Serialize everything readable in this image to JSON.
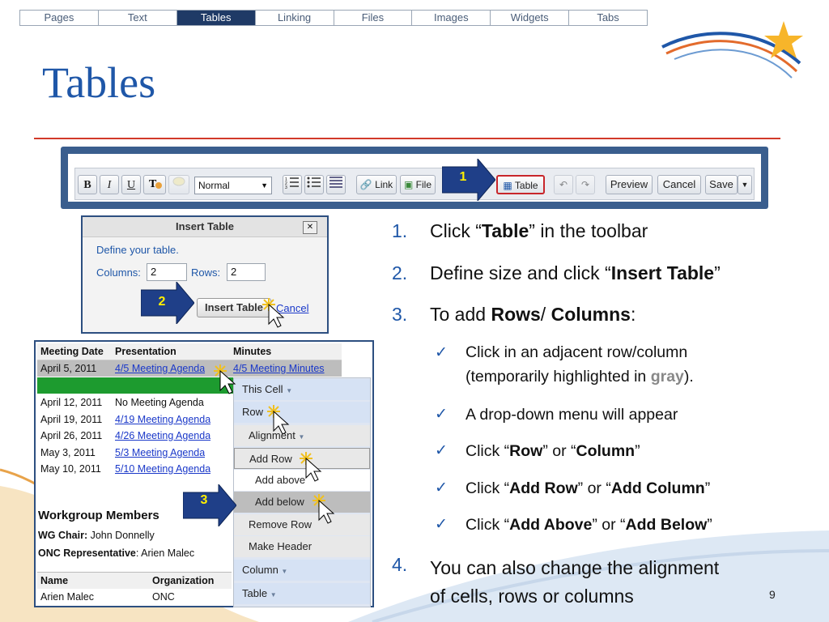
{
  "nav_tabs": [
    "Pages",
    "Text",
    "Tables",
    "Linking",
    "Files",
    "Images",
    "Widgets",
    "Tabs"
  ],
  "active_tab": "Tables",
  "title": "Tables",
  "toolbar": {
    "bold": "B",
    "italic": "I",
    "underline": "U",
    "format_value": "Normal",
    "link_label": "Link",
    "file_label": "File",
    "table_label": "Table",
    "preview_label": "Preview",
    "cancel_label": "Cancel",
    "save_label": "Save",
    "badge": "1"
  },
  "dialog": {
    "title": "Insert Table",
    "close": "✕",
    "prompt": "Define your table.",
    "columns_label": "Columns:",
    "columns_value": "2",
    "rows_label": "Rows:",
    "rows_value": "2",
    "insert_label": "Insert Table",
    "cancel_label": "Cancel",
    "badge": "2"
  },
  "meeting_table": {
    "headers": [
      "Meeting Date",
      "Presentation",
      "Minutes"
    ],
    "rows": [
      [
        "April 5, 2011",
        "4/5 Meeting Agenda",
        "4/5 Meeting Minutes"
      ],
      [
        "",
        "",
        ""
      ],
      [
        "April 12, 2011",
        "No Meeting Agenda",
        ""
      ],
      [
        "April 19, 2011",
        "4/19 Meeting Agenda",
        ""
      ],
      [
        "April 26, 2011",
        "4/26 Meeting Agenda",
        ""
      ],
      [
        "May 3, 2011",
        "5/3 Meeting Agenda",
        ""
      ],
      [
        "May 10, 2011",
        "5/10 Meeting Agenda",
        ""
      ]
    ],
    "section_title": "Workgroup Members",
    "wg_chair_label": "WG Chair:",
    "wg_chair_value": "John Donnelly",
    "onc_label": "ONC Representative",
    "onc_value": ": Arien Malec",
    "member_headers": [
      "Name",
      "Organization"
    ],
    "member_row": [
      "Arien Malec",
      "ONC"
    ],
    "badge": "3"
  },
  "context_menu": {
    "items": [
      "This Cell",
      "Row",
      "Alignment",
      "Add Row",
      "Add above",
      "Add below",
      "Remove Row",
      "Make Header",
      "Column",
      "Table"
    ]
  },
  "instructions": {
    "step1_a": "Click “",
    "step1_b": "Table",
    "step1_c": "” in the toolbar",
    "step2_a": "Define size and click “",
    "step2_b": "Insert Table",
    "step2_c": "”",
    "step3_a": "To add ",
    "step3_b": "Rows",
    "step3_c": "/ ",
    "step3_d": "Columns",
    "step3_e": ":",
    "b1_a": "Click in an adjacent row/column",
    "b1_b": "(temporarily highlighted in ",
    "b1_c": "gray",
    "b1_d": ").",
    "b2": "A drop-down menu will appear",
    "b3_a": "Click “",
    "b3_b": "Row",
    "b3_c": "” or “",
    "b3_d": "Column",
    "b3_e": "”",
    "b4_a": "Click “",
    "b4_b": "Add Row",
    "b4_c": "” or “",
    "b4_d": "Add Column",
    "b4_e": "”",
    "b5_a": "Click “",
    "b5_b": "Add Above",
    "b5_c": "” or “",
    "b5_d": "Add Below",
    "b5_e": "”",
    "step4_a": "You can also change the alignment",
    "step4_b": "of cells, rows or columns",
    "nums": [
      "1.",
      "2.",
      "3.",
      "4."
    ],
    "check": "✓"
  },
  "page_number": "9",
  "colors": {
    "title_blue": "#1f57a8",
    "rule_red": "#d23a2a",
    "nav_active": "#1f3a66",
    "star": "#f7b52a"
  }
}
